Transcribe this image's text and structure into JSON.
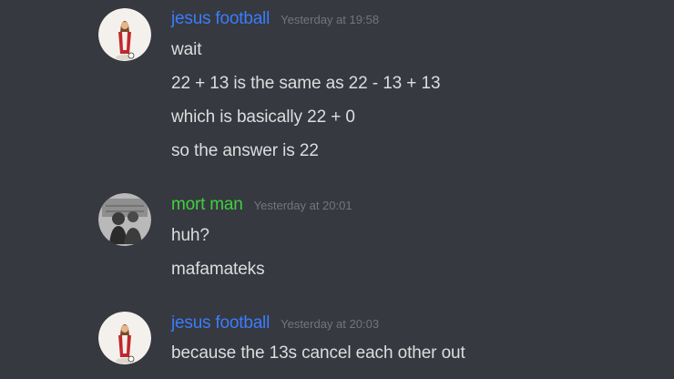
{
  "colors": {
    "background": "#36393f",
    "username_blue": "#3b7cff",
    "username_green": "#3fd13f",
    "message_text": "#dcddde",
    "timestamp": "#72767d"
  },
  "messages": [
    {
      "username": "jesus football",
      "timestamp": "Yesterday at 19:58",
      "avatar_icon": "jesus-avatar-icon",
      "lines": [
        "wait",
        "22 + 13 is the same as 22 - 13 + 13",
        "which is basically 22 + 0",
        "so the answer is 22"
      ]
    },
    {
      "username": "mort man",
      "timestamp": "Yesterday at 20:01",
      "avatar_icon": "mort-man-avatar-icon",
      "lines": [
        "huh?",
        "mafamateks"
      ]
    },
    {
      "username": "jesus football",
      "timestamp": "Yesterday at 20:03",
      "avatar_icon": "jesus-avatar-icon",
      "lines": [
        "because the 13s cancel each other out"
      ]
    }
  ]
}
